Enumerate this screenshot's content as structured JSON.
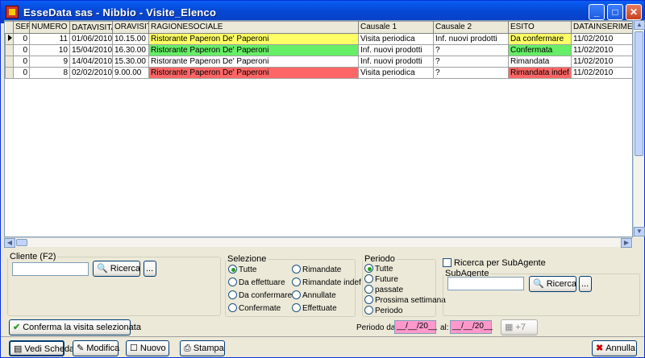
{
  "window": {
    "title": "EsseData sas - Nibbio - Visite_Elenco",
    "minimize": "_",
    "maximize": "□",
    "close": "✕"
  },
  "grid": {
    "columns": [
      "SER",
      "NUMERO",
      "DATAVISITA",
      "ORAVISIT",
      "RAGIONESOCIALE",
      "Causale 1",
      "Causale 2",
      "ESITO",
      "DATAINSERIMENT"
    ],
    "rows": [
      {
        "ser": "0",
        "numero": "11",
        "data": "01/06/2010",
        "ora": "10.15.00",
        "ragione": "Ristorante Paperon De' Paperoni",
        "causale1": "Visita periodica",
        "causale2": "Inf. nuovi prodotti",
        "esito": "Da confermare",
        "inserimento": "11/02/2010",
        "color": "#ffff66"
      },
      {
        "ser": "0",
        "numero": "10",
        "data": "15/04/2010",
        "ora": "16.30.00",
        "ragione": "Ristorante Paperon De' Paperoni",
        "causale1": "Inf. nuovi prodotti",
        "causale2": "?",
        "esito": "Confermata",
        "inserimento": "11/02/2010",
        "color": "#66ee66"
      },
      {
        "ser": "0",
        "numero": "9",
        "data": "14/04/2010",
        "ora": "15.30.00",
        "ragione": "Ristorante Paperon De' Paperoni",
        "causale1": "Inf. nuovi prodotti",
        "causale2": "?",
        "esito": "Rimandata",
        "inserimento": "11/02/2010",
        "color": "#ffffff"
      },
      {
        "ser": "0",
        "numero": "8",
        "data": "02/02/2010",
        "ora": "9.00.00",
        "ragione": "Ristorante Paperon De' Paperoni",
        "causale1": "Visita periodica",
        "causale2": "?",
        "esito": "Rimandata indef",
        "inserimento": "11/02/2010",
        "color": "#ff6666"
      }
    ]
  },
  "cliente": {
    "legend": "Cliente (F2)",
    "value": "",
    "search_label": "Ricerca",
    "dots_label": "..."
  },
  "selezione": {
    "legend": "Selezione",
    "options": [
      "Tutte",
      "Da effettuare",
      "Da confermare",
      "Confermate",
      "Rimandate",
      "Rimandate indef",
      "Annullate",
      "Effettuate"
    ],
    "selected": "Tutte"
  },
  "periodo": {
    "legend": "Periodo",
    "options": [
      "Tutte",
      "Future",
      "passate",
      "Prossima settimana",
      "Periodo"
    ],
    "selected": "Tutte",
    "dal_label": "Periodo dal:",
    "dal_value": "__/__/20__",
    "al_label": "al:",
    "al_value": "__/__/20__",
    "calendar_label": "+7"
  },
  "subagente": {
    "checkbox_label": "Ricerca per SubAgente",
    "legend": "SubAgente",
    "value": "",
    "search_label": "Ricerca",
    "dots_label": "..."
  },
  "actions": {
    "conferma_label": "Conferma la visita selezionata",
    "vedi_label": "Vedi Scheda",
    "modifica_label": "Modifica",
    "nuovo_label": "Nuovo",
    "stampa_label": "Stampa",
    "annulla_label": "Annulla"
  }
}
